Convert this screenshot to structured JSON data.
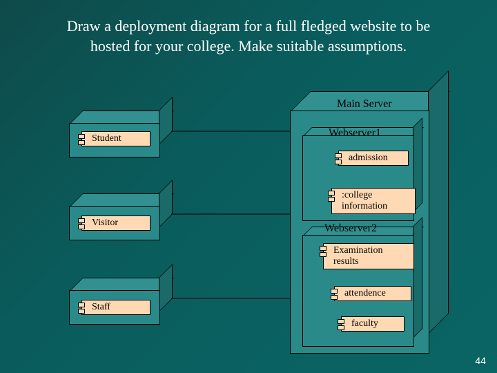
{
  "title_line1": "Draw a deployment diagram for a full fledged website to be",
  "title_line2": "hosted for your college. Make suitable assumptions.",
  "clients": {
    "student": "Student",
    "visitor": "Visitor",
    "staff": "Staff"
  },
  "server": {
    "title": "Main Server",
    "web1": "Webserver1",
    "web2": "Webserver2",
    "components": {
      "admission": "admission",
      "collegeinfo": ":college information",
      "exam": "Examination results",
      "attendence": "attendence",
      "faculty": "faculty"
    }
  },
  "page_number": "44"
}
